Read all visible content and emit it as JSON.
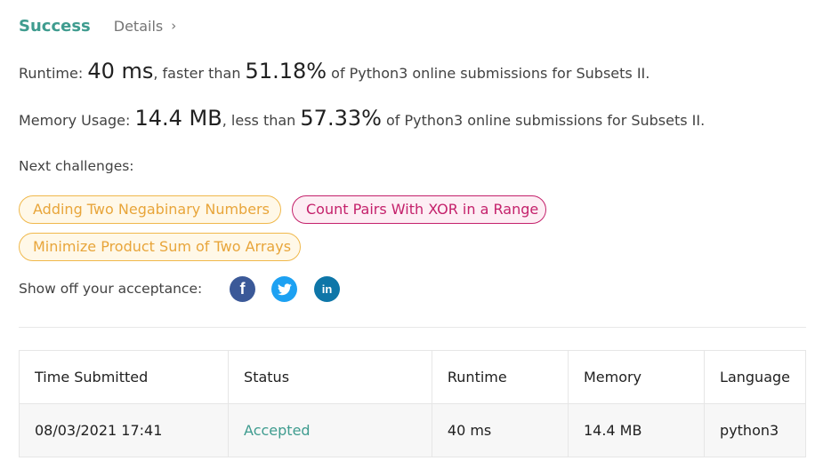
{
  "header": {
    "success_label": "Success",
    "details_label": "Details",
    "details_chevron": "›"
  },
  "runtime": {
    "label": "Runtime: ",
    "value": "40 ms",
    "middle": ", faster than ",
    "percent": "51.18%",
    "suffix": " of Python3 online submissions for Subsets II."
  },
  "memory": {
    "label": "Memory Usage: ",
    "value": "14.4 MB",
    "middle": ", less than ",
    "percent": "57.33%",
    "suffix": " of Python3 online submissions for Subsets II."
  },
  "next_challenges": {
    "label": "Next challenges:",
    "items": [
      {
        "title": "Adding Two Negabinary Numbers",
        "difficulty": "medium"
      },
      {
        "title": "Count Pairs With XOR in a Range",
        "difficulty": "hard"
      },
      {
        "title": "Minimize Product Sum of Two Arrays",
        "difficulty": "medium"
      }
    ]
  },
  "share": {
    "label": "Show off your acceptance:",
    "icons": [
      "facebook-icon",
      "twitter-icon",
      "linkedin-icon"
    ],
    "facebook_glyph": "f",
    "linkedin_glyph": "in"
  },
  "table": {
    "headers": [
      "Time Submitted",
      "Status",
      "Runtime",
      "Memory",
      "Language"
    ],
    "rows": [
      [
        "08/03/2021 17:41",
        "Accepted",
        "40 ms",
        "14.4 MB",
        "python3"
      ]
    ]
  },
  "colors": {
    "success": "#3f9c8f",
    "medium_border": "#f0b84b",
    "hard_border": "#c4216b",
    "facebook": "#3b5998",
    "twitter": "#1da1f2",
    "linkedin": "#0e76a8"
  }
}
